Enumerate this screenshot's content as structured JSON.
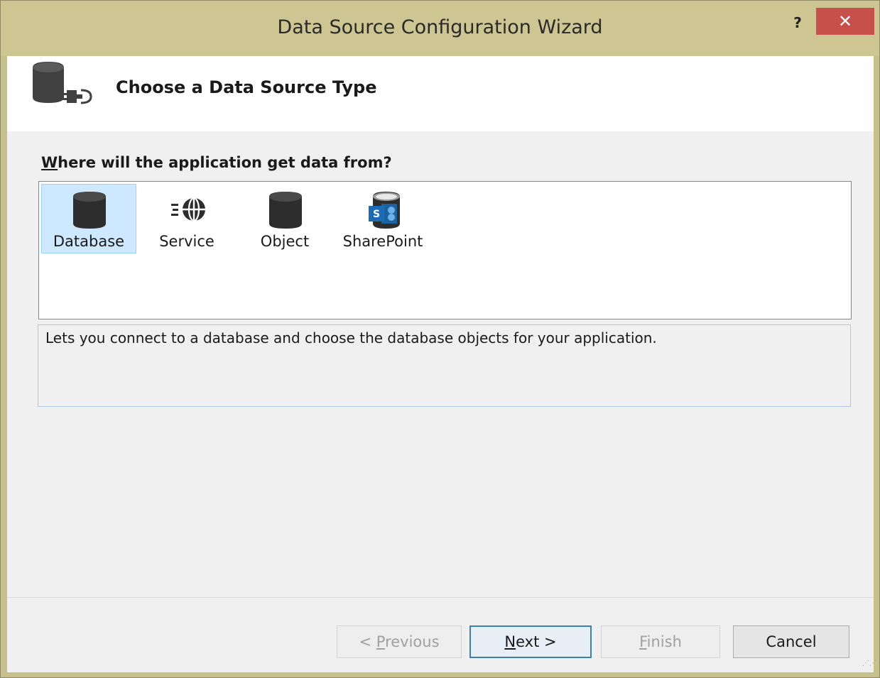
{
  "window": {
    "title": "Data Source Configuration Wizard",
    "help_label": "?",
    "close_label": "✕"
  },
  "header": {
    "title": "Choose a Data Source Type",
    "icon": "database-connect-icon"
  },
  "prompt": {
    "accesskey": "W",
    "rest": "here will the application get data from?"
  },
  "data_source_types": [
    {
      "label": "Database",
      "icon": "database-icon",
      "selected": true
    },
    {
      "label": "Service",
      "icon": "web-service-icon",
      "selected": false
    },
    {
      "label": "Object",
      "icon": "object-icon",
      "selected": false
    },
    {
      "label": "SharePoint",
      "icon": "sharepoint-icon",
      "selected": false
    }
  ],
  "description": "Lets you connect to a database and choose the database objects for your application.",
  "buttons": {
    "previous": {
      "pre": "< ",
      "ak": "P",
      "rest": "revious",
      "enabled": false
    },
    "next": {
      "ak": "N",
      "rest": "ext >",
      "enabled": true,
      "default": true
    },
    "finish": {
      "ak": "F",
      "rest": "inish",
      "enabled": false
    },
    "cancel": {
      "label": "Cancel",
      "enabled": true
    }
  },
  "colors": {
    "title_bar": "#cdc592",
    "close_button": "#c7504a",
    "selection": "#cde8ff",
    "default_button_border": "#3c7fb1"
  }
}
